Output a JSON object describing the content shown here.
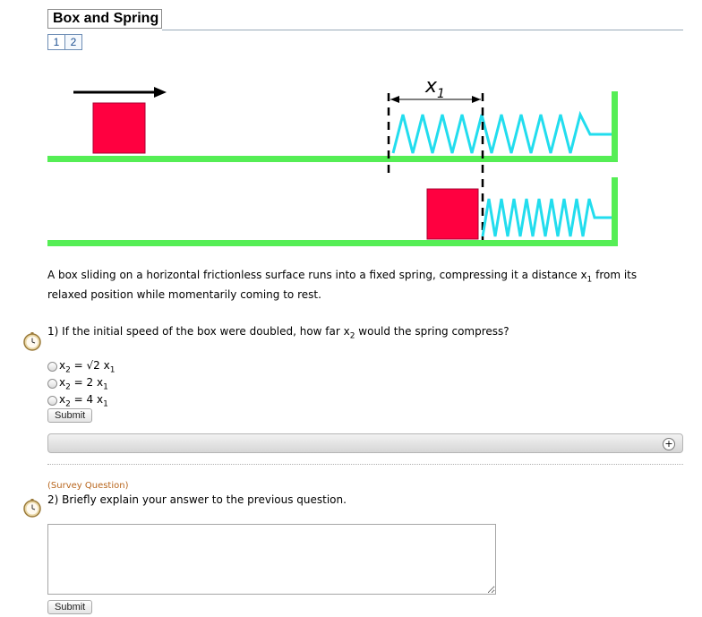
{
  "header": {
    "title": "Box and Spring",
    "pages": [
      "1",
      "2"
    ]
  },
  "figure": {
    "x_label": "x",
    "x_subscript": "1",
    "colors": {
      "box": "#ff0040",
      "floor": "#55ee55",
      "spring": "#22ddee",
      "wall": "#55ee55",
      "arrow": "#000000"
    }
  },
  "intro": {
    "part1": "A box sliding on a horizontal frictionless surface runs into a fixed spring, compressing it a distance x",
    "sub": "1",
    "part2": " from its relaxed position while momentarily coming to rest."
  },
  "question1": {
    "number": "1)",
    "text_before": "If the initial speed of the box were doubled, how far x",
    "text_sub": "2",
    "text_after": " would the spring compress?",
    "choices": [
      {
        "lhs": "x",
        "lhs_sub": "2",
        "rhs": " = √2 x",
        "rhs_sub": "1"
      },
      {
        "lhs": "x",
        "lhs_sub": "2",
        "rhs": " = 2 x",
        "rhs_sub": "1"
      },
      {
        "lhs": "x",
        "lhs_sub": "2",
        "rhs": " = 4 x",
        "rhs_sub": "1"
      }
    ],
    "submit_label": "Submit",
    "feedback_icon": "plus-icon"
  },
  "question2": {
    "survey_label": "(Survey Question)",
    "number": "2)",
    "text": "Briefly explain your answer to the previous question.",
    "answer_value": "",
    "submit_label": "Submit"
  },
  "icons": {
    "question_timer": "stopwatch-icon"
  }
}
